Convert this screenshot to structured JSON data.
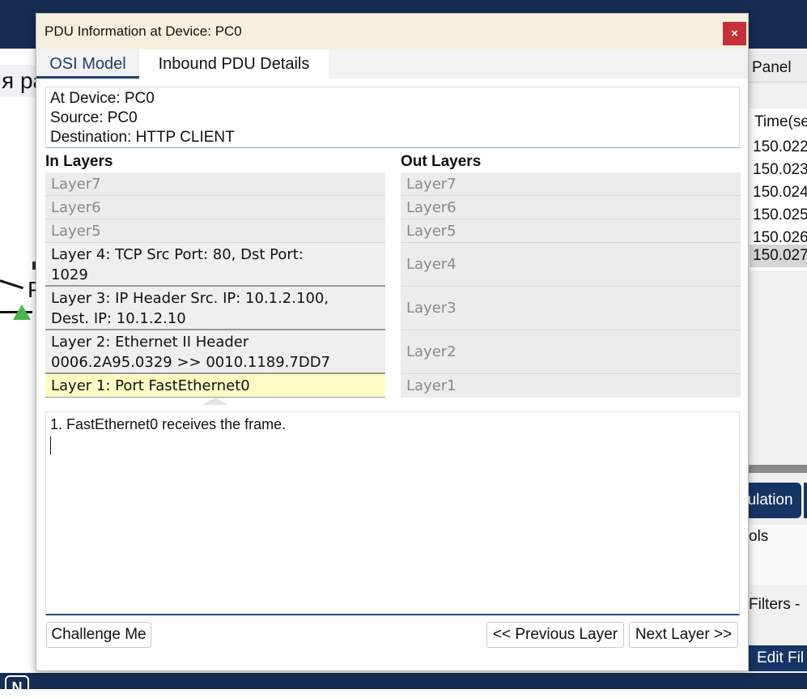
{
  "background_app": {
    "left_fragment_text": "я ра",
    "left_device_label": "P",
    "right_panel": {
      "header": "Panel",
      "time_header": "Time(se",
      "times": [
        "150.022",
        "150.023",
        "150.024",
        "150.025",
        "150.026",
        "150.027"
      ],
      "selected_time_index": 5,
      "simulation_tab": "nulation",
      "tools_label": "ols",
      "filters_label": "Filters -",
      "edit_filters_label": "Edit Fil"
    },
    "bottom_icon_letter": "N"
  },
  "dialog": {
    "title": "PDU Information at Device: PC0",
    "close_glyph": "×",
    "tabs": [
      {
        "label": "OSI Model",
        "active": true
      },
      {
        "label": "Inbound PDU Details",
        "active": false
      }
    ],
    "info": {
      "at_device": "At Device: PC0",
      "source": "Source: PC0",
      "destination": "Destination: HTTP CLIENT"
    },
    "in_layers_title": "In Layers",
    "out_layers_title": "Out Layers",
    "in_layers": [
      {
        "line1": "Layer7",
        "line2": ""
      },
      {
        "line1": "Layer6",
        "line2": ""
      },
      {
        "line1": "Layer5",
        "line2": ""
      },
      {
        "line1": "Layer 4: TCP Src Port: 80, Dst Port:",
        "line2": "1029"
      },
      {
        "line1": "Layer 3: IP Header Src. IP: 10.1.2.100,",
        "line2": "Dest. IP: 10.1.2.10"
      },
      {
        "line1": "Layer 2: Ethernet II Header",
        "line2": "0006.2A95.0329 >> 0010.1189.7DD7"
      },
      {
        "line1": "Layer 1: Port FastEthernet0",
        "line2": ""
      }
    ],
    "out_layers": [
      "Layer7",
      "Layer6",
      "Layer5",
      "Layer4",
      "Layer3",
      "Layer2",
      "Layer1"
    ],
    "description": "1. FastEthernet0 receives the frame.",
    "buttons": {
      "challenge": "Challenge Me",
      "previous": "<< Previous Layer",
      "next": "Next Layer >>"
    }
  },
  "colors": {
    "app_navy": "#162c52",
    "title_bar": "#f6efdf",
    "close_red": "#c6303a",
    "highlight_yellow": "#fdfcc4",
    "tab_accent": "#1d3f6e"
  }
}
